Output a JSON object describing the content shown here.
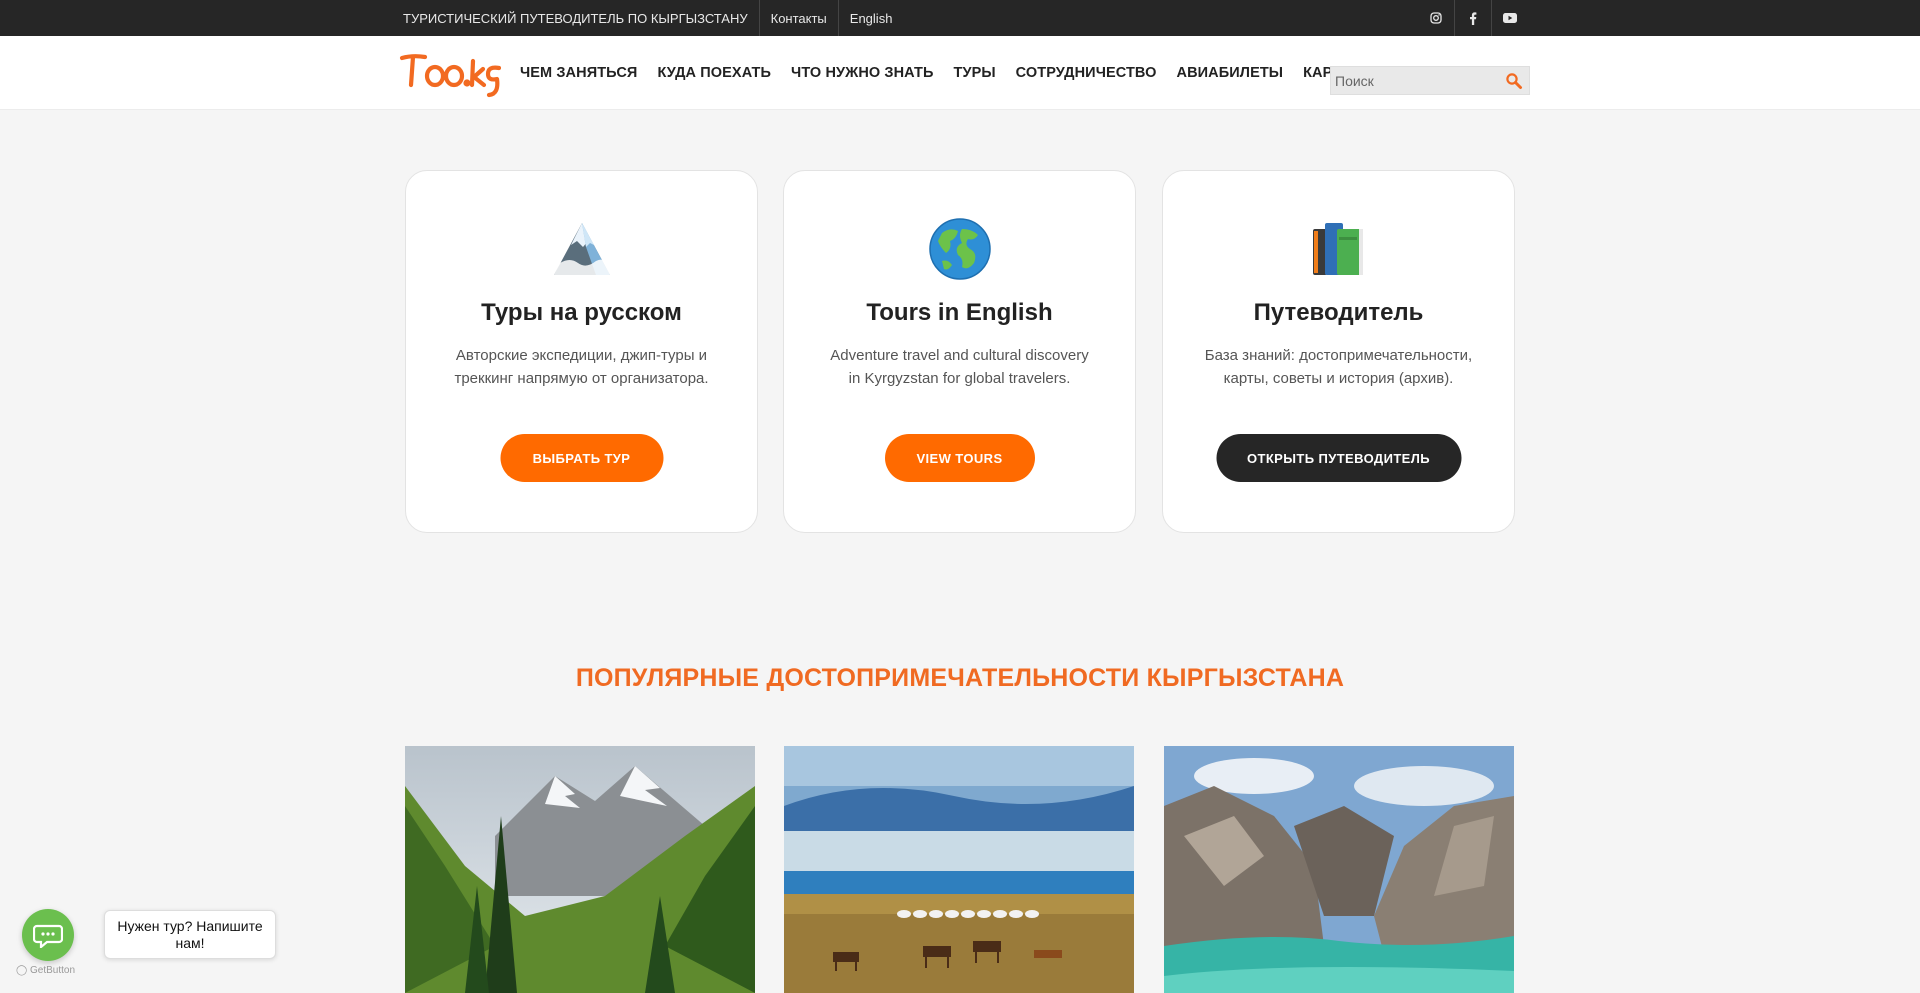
{
  "topbar": {
    "tagline": "ТУРИСТИЧЕСКИЙ ПУТЕВОДИТЕЛЬ ПО КЫРГЫЗСТАНУ",
    "contacts": "Контакты",
    "language": "English",
    "social_icons": [
      "instagram-icon",
      "facebook-icon",
      "youtube-icon"
    ]
  },
  "header": {
    "logo_text": "Too.kg",
    "nav": [
      "ЧЕМ ЗАНЯТЬСЯ",
      "КУДА ПОЕХАТЬ",
      "ЧТО НУЖНО ЗНАТЬ",
      "ТУРЫ",
      "СОТРУДНИЧЕСТВО",
      "АВИАБИЛЕТЫ",
      "КАРТА"
    ],
    "search_placeholder": "Поиск"
  },
  "cards": [
    {
      "icon": "mountain-icon",
      "title": "Туры на русском",
      "text": "Авторские экспедиции, джип-туры и треккинг напрямую от организатора.",
      "button": "ВЫБРАТЬ ТУР"
    },
    {
      "icon": "globe-icon",
      "title": "Tours in English",
      "text": "Adventure travel and cultural discovery in Kyrgyzstan for global travelers.",
      "button": "VIEW TOURS"
    },
    {
      "icon": "books-icon",
      "title": "Путеводитель",
      "text": "База знаний: достопримечательности, карты, советы и история (архив).",
      "button": "ОТКРЫТЬ ПУТЕВОДИТЕЛЬ"
    }
  ],
  "section_title": "ПОПУЛЯРНЫЕ ДОСТОПРИМЕЧАТЕЛЬНОСТИ КЫРГЫЗСТАНА",
  "chat": {
    "bubble": "Нужен тур? Напишите нам!",
    "branding": "GetButton"
  },
  "colors": {
    "accent": "#ff6a00",
    "section_title": "#f06a22",
    "dark": "#262626",
    "chat_green": "#6bbf4e"
  }
}
